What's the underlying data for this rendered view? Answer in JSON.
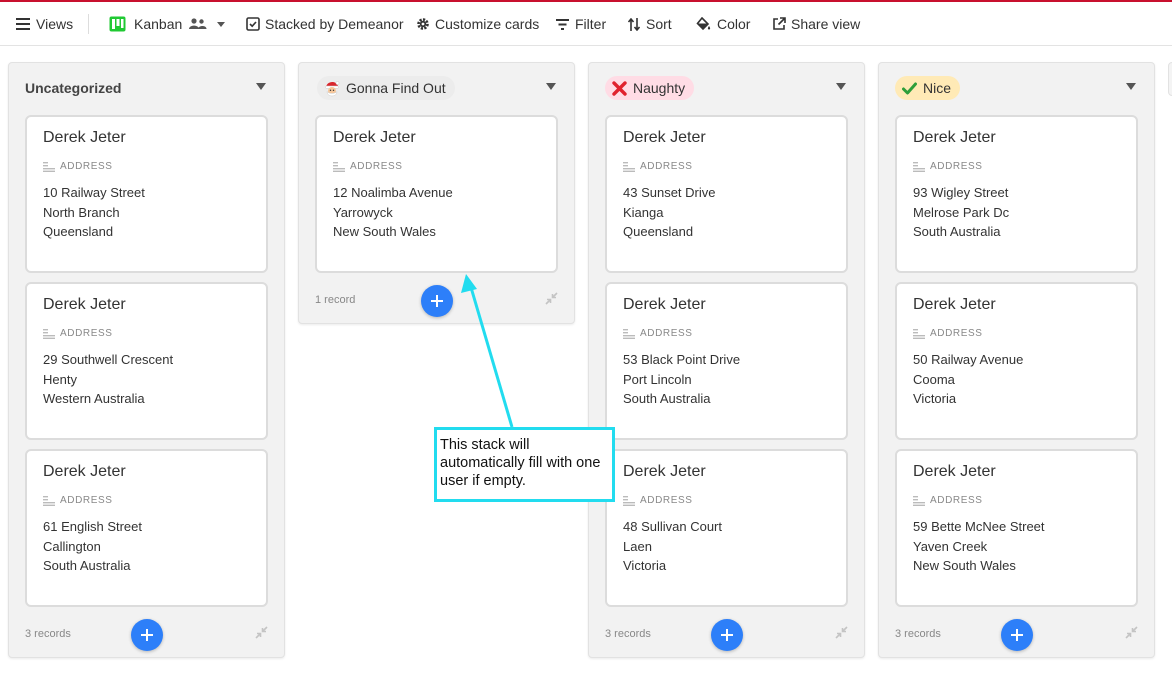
{
  "toolbar": {
    "views_label": "Views",
    "view_name": "Kanban",
    "stacked_label": "Stacked by Demeanor",
    "customize_label": "Customize cards",
    "filter_label": "Filter",
    "sort_label": "Sort",
    "color_label": "Color",
    "share_label": "Share view"
  },
  "field_label": "ADDRESS",
  "stacks": [
    {
      "title": "Uncategorized",
      "count": "3 records",
      "cards": [
        {
          "name": "Derek Jeter",
          "line1": "10 Railway Street",
          "line2": "North Branch",
          "line3": "Queensland"
        },
        {
          "name": "Derek Jeter",
          "line1": "29 Southwell Crescent",
          "line2": "Henty",
          "line3": "Western Australia"
        },
        {
          "name": "Derek Jeter",
          "line1": "61 English Street",
          "line2": "Callington",
          "line3": "South Australia"
        }
      ]
    },
    {
      "title": "Gonna Find Out",
      "emoji": "santa-face-icon",
      "count": "1 record",
      "cards": [
        {
          "name": "Derek Jeter",
          "line1": "12 Noalimba Avenue",
          "line2": "Yarrowyck",
          "line3": "New South Wales"
        }
      ]
    },
    {
      "title": "Naughty",
      "emoji": "red-x-icon",
      "pill_color": "#ffdce5",
      "count": "3 records",
      "cards": [
        {
          "name": "Derek Jeter",
          "line1": "43 Sunset Drive",
          "line2": "Kianga",
          "line3": "Queensland"
        },
        {
          "name": "Derek Jeter",
          "line1": "53 Black Point Drive",
          "line2": "Port Lincoln",
          "line3": "South Australia"
        },
        {
          "name": "Derek Jeter",
          "line1": "48 Sullivan Court",
          "line2": "Laen",
          "line3": "Victoria"
        }
      ]
    },
    {
      "title": "Nice",
      "emoji": "green-check-icon",
      "pill_color": "#ffeab6",
      "count": "3 records",
      "cards": [
        {
          "name": "Derek Jeter",
          "line1": "93 Wigley Street",
          "line2": "Melrose Park Dc",
          "line3": "South Australia"
        },
        {
          "name": "Derek Jeter",
          "line1": "50 Railway Avenue",
          "line2": "Cooma",
          "line3": "Victoria"
        },
        {
          "name": "Derek Jeter",
          "line1": "59 Bette McNee Street",
          "line2": "Yaven Creek",
          "line3": "New South Wales"
        }
      ]
    }
  ],
  "annotation": {
    "text": "This stack will automatically fill with one user if empty.",
    "border_color": "#22dcef"
  },
  "colors": {
    "accent_blue": "#2d7ff9",
    "top_bar": "#c8102e"
  }
}
